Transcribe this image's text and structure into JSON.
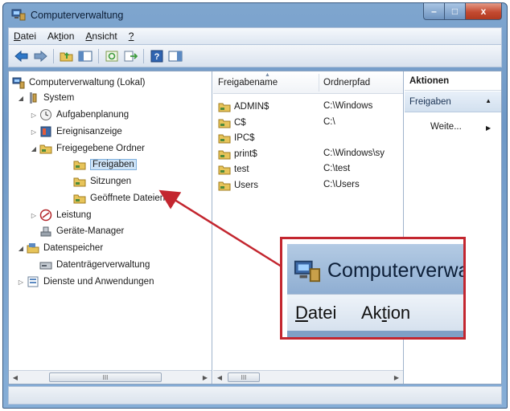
{
  "window": {
    "title": "Computerverwaltung",
    "controls": {
      "minimize": "–",
      "maximize": "□",
      "close": "x"
    }
  },
  "menubar": {
    "items": [
      {
        "label_ul": "D",
        "label_rest": "atei"
      },
      {
        "label_pre": "Ak",
        "label_ul": "t",
        "label_rest": "ion"
      },
      {
        "label_ul": "A",
        "label_rest": "nsicht"
      },
      {
        "label_ul": "?",
        "label_rest": ""
      }
    ]
  },
  "toolbar": {
    "buttons": [
      "back-arrow-icon",
      "forward-arrow-icon",
      "up-folder-icon",
      "show-hide-tree-icon",
      "refresh-icon",
      "export-icon",
      "help-icon",
      "console-icon"
    ]
  },
  "tree": {
    "items": [
      {
        "label": "Computerverwaltung (Lokal)",
        "expander": "",
        "icon": "computer-management-icon",
        "level": 0
      },
      {
        "label": "System",
        "expander": "◢",
        "icon": "system-tools-icon",
        "level": 1
      },
      {
        "label": "Aufgabenplanung",
        "expander": "▷",
        "icon": "clock-icon",
        "level": 2
      },
      {
        "label": "Ereignisanzeige",
        "expander": "▷",
        "icon": "event-viewer-icon",
        "level": 2
      },
      {
        "label": "Freigegebene Ordner",
        "expander": "◢",
        "icon": "shared-folder-icon",
        "level": 2
      },
      {
        "label": "Freigaben",
        "expander": "",
        "icon": "shared-folder-icon",
        "level": 3,
        "selected": true
      },
      {
        "label": "Sitzungen",
        "expander": "",
        "icon": "shared-folder-icon",
        "level": 3
      },
      {
        "label": "Geöffnete Dateien",
        "expander": "",
        "icon": "shared-folder-icon",
        "level": 3
      },
      {
        "label": "Leistung",
        "expander": "▷",
        "icon": "performance-icon",
        "level": 2
      },
      {
        "label": "Geräte-Manager",
        "expander": "",
        "icon": "device-manager-icon",
        "level": 2
      },
      {
        "label": "Datenspeicher",
        "expander": "◢",
        "icon": "storage-icon",
        "level": 1
      },
      {
        "label": "Datenträgerverwaltung",
        "expander": "",
        "icon": "disk-management-icon",
        "level": 2
      },
      {
        "label": "Dienste und Anwendungen",
        "expander": "▷",
        "icon": "services-icon",
        "level": 1
      }
    ],
    "scroll_thumb_label": "III"
  },
  "list": {
    "columns": [
      "Freigabename",
      "Ordnerpfad"
    ],
    "rows": [
      {
        "name": "ADMIN$",
        "path": "C:\\Windows"
      },
      {
        "name": "C$",
        "path": "C:\\"
      },
      {
        "name": "IPC$",
        "path": ""
      },
      {
        "name": "print$",
        "path": "C:\\Windows\\sy"
      },
      {
        "name": "test",
        "path": "C:\\test"
      },
      {
        "name": "Users",
        "path": "C:\\Users"
      }
    ],
    "scroll_thumb_label": "III"
  },
  "actions": {
    "header": "Aktionen",
    "section": "Freigaben",
    "item": "Weite..."
  },
  "zoom": {
    "title": "Computerverwa",
    "menu": [
      {
        "label_ul": "D",
        "label_rest": "atei"
      },
      {
        "label_pre": "Ak",
        "label_ul": "t",
        "label_rest": "ion"
      }
    ]
  },
  "colors": {
    "highlight_border": "#c3262f",
    "selection": "#cde3f7",
    "window_frame": "#7fa6cf"
  }
}
